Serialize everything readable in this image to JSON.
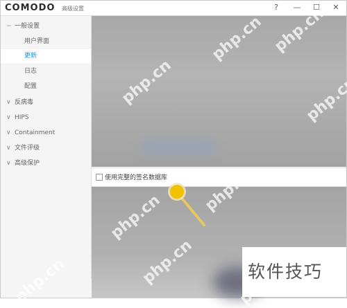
{
  "window": {
    "brand": "COMODO",
    "title": "高级设置",
    "controls": {
      "help": "?",
      "minimize": "—",
      "maximize": "☐",
      "close": "✕"
    }
  },
  "sidebar": {
    "groups": [
      {
        "label": "一般设置",
        "chev": "−",
        "expanded": true
      },
      {
        "label": "反病毒",
        "chev": "∨"
      },
      {
        "label": "HIPS",
        "chev": "∨"
      },
      {
        "label": "Containment",
        "chev": "∨"
      },
      {
        "label": "文件评级",
        "chev": "∨"
      },
      {
        "label": "高级保护",
        "chev": "∨"
      }
    ],
    "items": [
      {
        "label": "用户界面"
      },
      {
        "label": "更新",
        "active": true
      },
      {
        "label": "日志"
      },
      {
        "label": "配置"
      }
    ]
  },
  "content": {
    "option": {
      "label": "使用完整的签名数据库",
      "checked": false
    }
  },
  "watermarks": {
    "site": "php.cn",
    "box_text": "软件技巧"
  },
  "colors": {
    "accent": "#1a8fe0",
    "pointer": "#f2c200"
  }
}
